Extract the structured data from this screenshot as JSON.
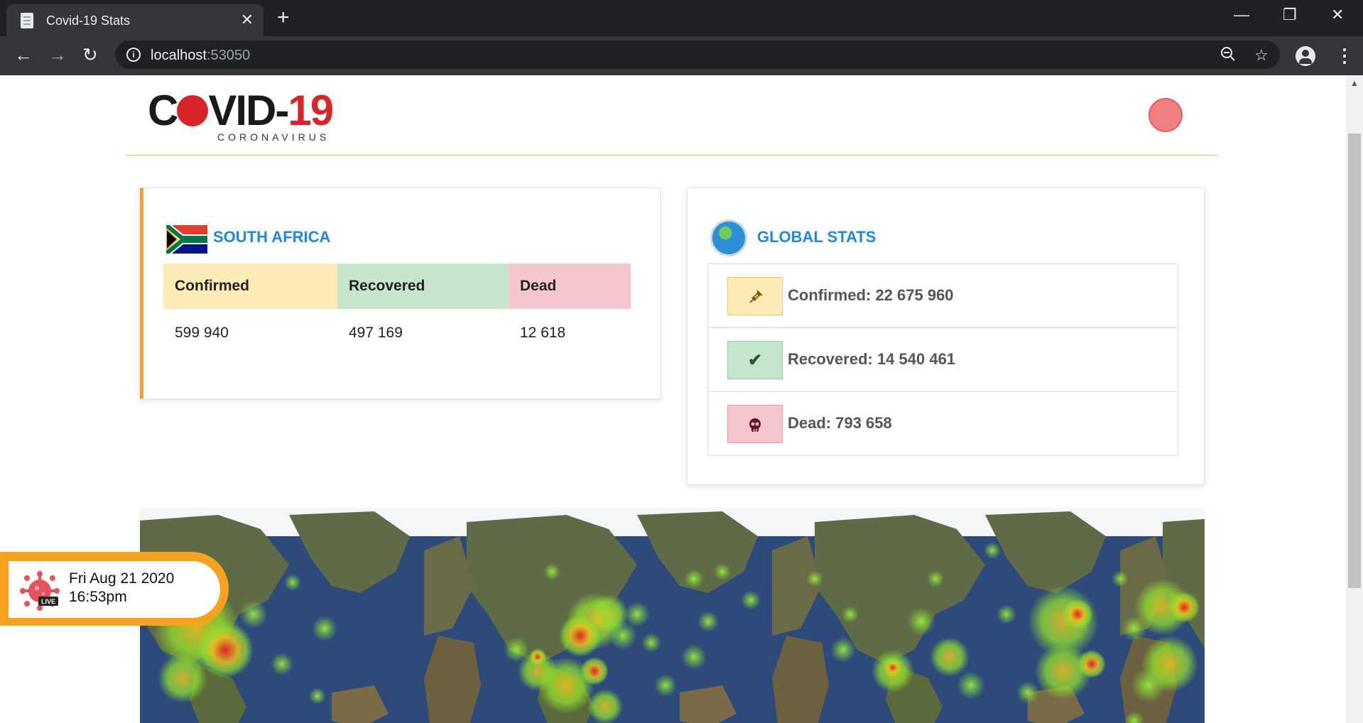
{
  "browser": {
    "tab_title": "Covid-19 Stats",
    "tab_close": "✕",
    "new_tab": "+",
    "url_host": "localhost",
    "url_port": ":53050"
  },
  "header": {
    "logo_text_left": "C",
    "logo_text_right": "VID-",
    "logo_text_num": "19",
    "logo_sub": "CORONAVIRUS"
  },
  "south_africa": {
    "title": "SOUTH AFRICA",
    "headers": [
      "Confirmed",
      "Recovered",
      "Dead"
    ],
    "header_colors": [
      "#fdebb8",
      "#c5e6cc",
      "#f5c6cb"
    ],
    "values": [
      "599 940",
      "497 169",
      "12 618"
    ]
  },
  "global": {
    "title": "GLOBAL STATS",
    "items": [
      {
        "label": "Confirmed: 22 675 960",
        "icon": "syringe-icon",
        "color": "#fdebb8",
        "border": "#f0c850"
      },
      {
        "label": "Recovered: 14 540 461",
        "icon": "check-icon",
        "color": "#c5e6cc",
        "border": "#8fcf9f"
      },
      {
        "label": "Dead: 793 658",
        "icon": "skull-icon",
        "color": "#f5c6cb",
        "border": "#e89aa2"
      }
    ]
  },
  "live_widget": {
    "date": "Fri Aug 21 2020",
    "time": "16:53pm",
    "badge": "LIVE"
  },
  "colors": {
    "accent_blue": "#1e88e5",
    "accent_orange": "#f0a23a",
    "divider_gold": "#e6c04a",
    "status_dot": "#f08080"
  }
}
